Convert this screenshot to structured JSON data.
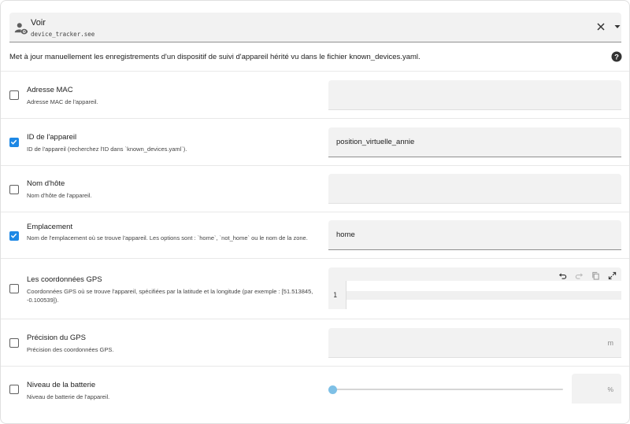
{
  "service": {
    "name": "Voir",
    "id": "device_tracker.see",
    "icon": "account-eye-icon"
  },
  "description": "Met à jour manuellement les enregistrements d'un dispositif de suivi d'appareil hérité vu dans le fichier known_devices.yaml.",
  "fields": [
    {
      "name": "Adresse MAC",
      "description": "Adresse MAC de l'appareil.",
      "checked": false,
      "value": ""
    },
    {
      "name": "ID de l'appareil",
      "description": "ID de l'appareil (recherchez l'ID dans `known_devices.yaml`).",
      "checked": true,
      "value": "position_virtuelle_annie"
    },
    {
      "name": "Nom d'hôte",
      "description": "Nom d'hôte de l'appareil.",
      "checked": false,
      "value": ""
    },
    {
      "name": "Emplacement",
      "description": "Nom de l'emplacement où se trouve l'appareil. Les options sont : `home`, `not_home` ou le nom de la zone.",
      "checked": true,
      "value": "home"
    },
    {
      "name": "Les coordonnées GPS",
      "description": "Coordonnées GPS où se trouve l'appareil, spécifiées par la latitude et la longitude (par exemple : [51.513845, -0.100539]).",
      "checked": false,
      "editor_line_number": "1"
    },
    {
      "name": "Précision du GPS",
      "description": "Précision des coordonnées GPS.",
      "checked": false,
      "unit": "m"
    },
    {
      "name": "Niveau de la batterie",
      "description": "Niveau de batterie de l'appareil.",
      "checked": false,
      "unit": "%",
      "slider_fraction": 0
    }
  ],
  "colors": {
    "accent": "#1e88e5",
    "slider_thumb": "#7ec0e6",
    "input_bg": "#f2f2f2"
  }
}
